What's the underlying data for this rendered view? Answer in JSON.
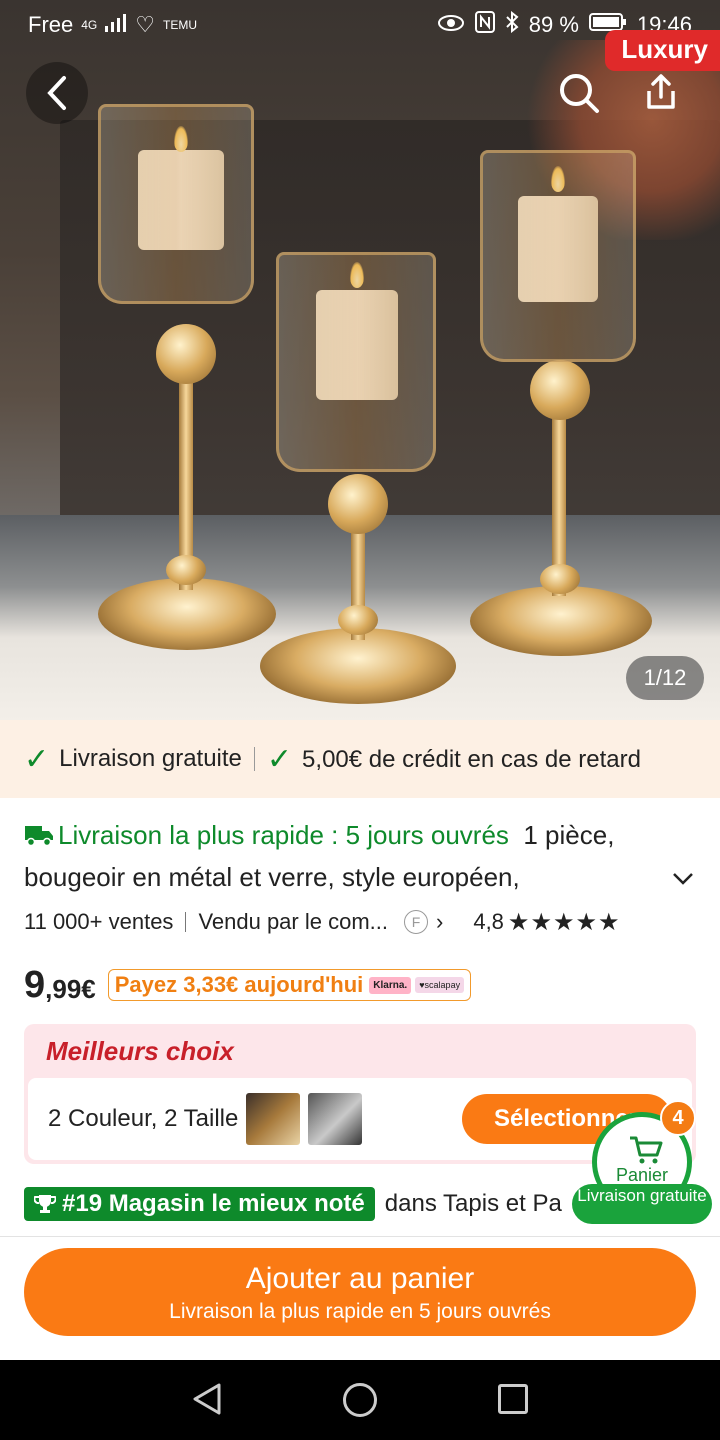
{
  "status_bar": {
    "carrier": "Free",
    "network": "4G",
    "app_small": "TEMU",
    "battery": "89 %",
    "time": "19:46"
  },
  "badge": {
    "luxury": "Luxury"
  },
  "gallery": {
    "counter": "1/12"
  },
  "delivery_strip": {
    "free_delivery": "Livraison gratuite",
    "credit": "5,00€ de crédit en cas de retard"
  },
  "product": {
    "fast_delivery": "Livraison la plus rapide : 5 jours ouvrés",
    "title": "1 pièce, bougeoir en métal et verre, style européen,",
    "sales": "11 000+ ventes",
    "seller": "Vendu par le com...",
    "seller_badge": "F",
    "rating": "4,8",
    "stars": "★★★★★",
    "price_int": "9",
    "price_dec": ",99€",
    "pay_today": "Payez 3,33€ aujourd'hui",
    "klarna": "Klarna.",
    "scalapay": "♥scalapay"
  },
  "best_choices": {
    "title": "Meilleurs choix",
    "variants": "2 Couleur, 2 Taille",
    "select_label": "Sélectionner"
  },
  "cart": {
    "label": "Panier",
    "count": "4",
    "delivery": "Livraison gratuite"
  },
  "ranking": {
    "badge": "#19 Magasin le mieux noté",
    "text": "dans Tapis et Pa"
  },
  "add_to_cart": {
    "label": "Ajouter au panier",
    "sub": "Livraison la plus rapide en 5 jours ouvrés"
  },
  "colors": {
    "accent_orange": "#fa7a14",
    "green": "#0e8a2b",
    "red": "#e02a2a"
  }
}
